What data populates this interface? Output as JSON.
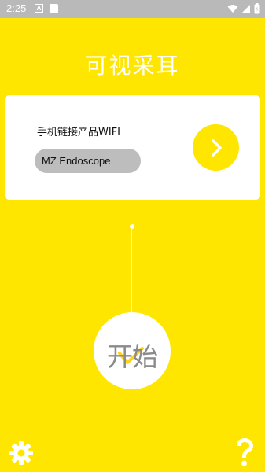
{
  "status_bar": {
    "time": "2:25",
    "notification_letter": "A"
  },
  "app": {
    "title": "可视采耳"
  },
  "wifi_card": {
    "label": "手机链接产品WIFI",
    "ssid": "MZ Endoscope"
  },
  "start": {
    "label": "开始"
  },
  "icons": {
    "next": "chevron-right-icon",
    "settings": "gear-icon",
    "help": "question-mark-icon",
    "start_check": "check-icon"
  },
  "colors": {
    "background": "#FFE600",
    "card": "#FFFFFF",
    "pill": "#BDBDBD",
    "status_bar": "#B9B9B9",
    "start_text": "#8A8A8A"
  }
}
